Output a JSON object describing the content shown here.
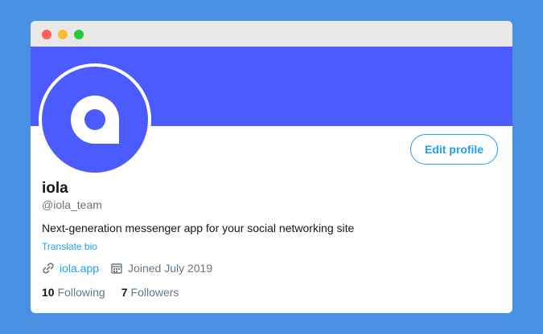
{
  "profile": {
    "name": "iola",
    "handle": "@iola_team",
    "bio": "Next-generation messenger app for your social networking site",
    "translate_label": "Translate bio",
    "website": "iola.app",
    "joined": "Joined July 2019",
    "following_count": "10",
    "following_label": "Following",
    "followers_count": "7",
    "followers_label": "Followers",
    "edit_label": "Edit profile"
  },
  "colors": {
    "banner": "#4c5bff",
    "accent": "#1da1f2",
    "background": "#4a90e2"
  },
  "icons": {
    "avatar": "iola-logo-icon",
    "website": "link-icon",
    "joined": "calendar-icon"
  }
}
